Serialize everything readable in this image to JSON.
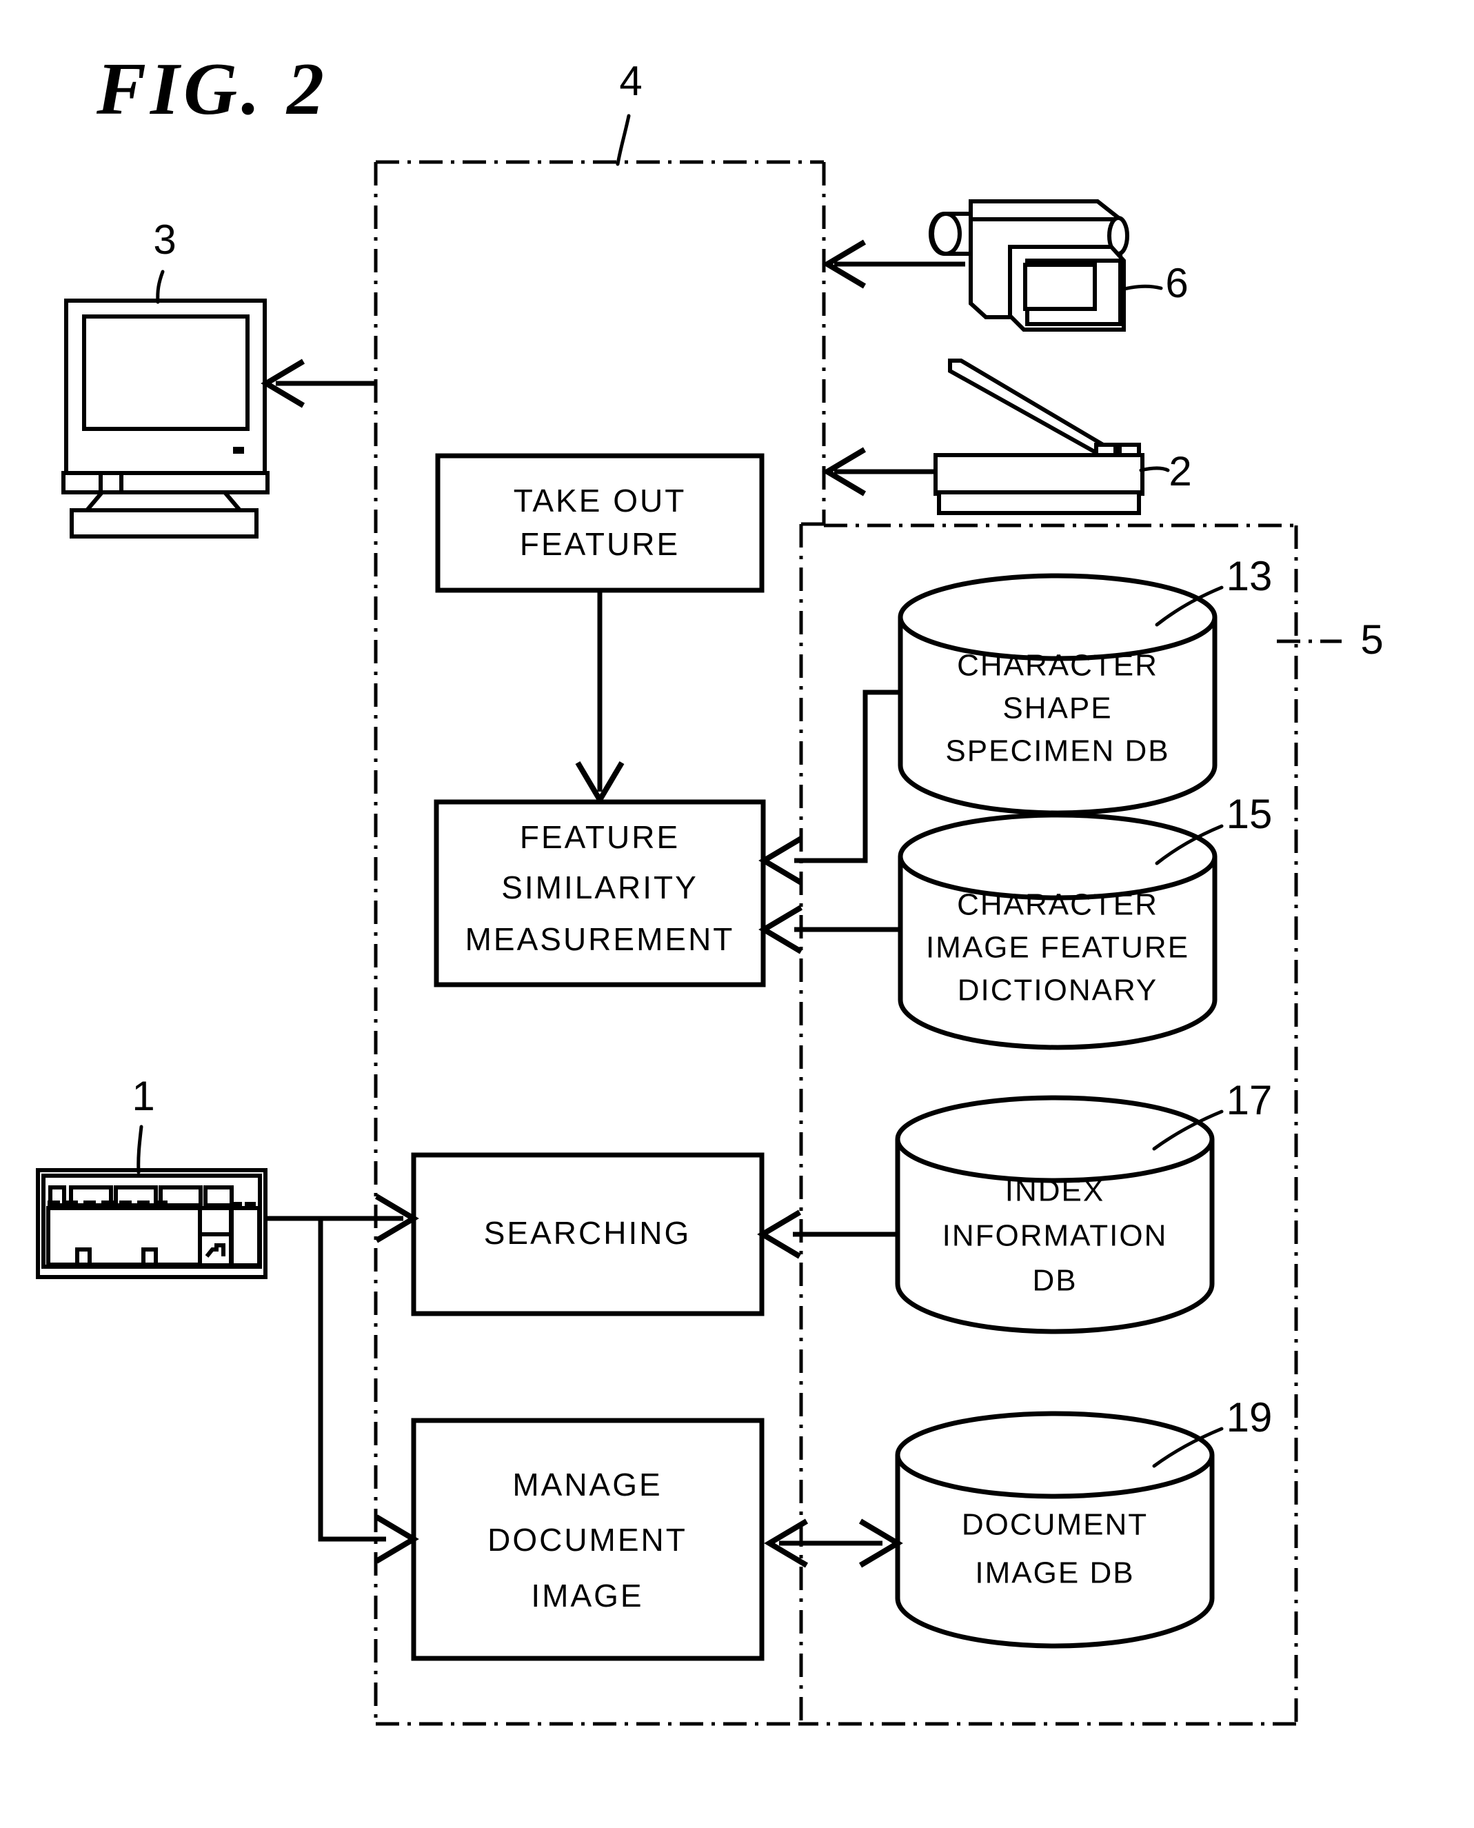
{
  "figure": {
    "title": "FIG. 2",
    "domain": "patent-block-diagram"
  },
  "process_boxes": [
    {
      "id": "take-out-feature",
      "lines": [
        "TAKE OUT",
        "FEATURE"
      ]
    },
    {
      "id": "feature-similarity-measurement",
      "lines": [
        "FEATURE",
        "SIMILARITY",
        "MEASUREMENT"
      ]
    },
    {
      "id": "searching",
      "lines": [
        "SEARCHING"
      ]
    },
    {
      "id": "manage-document-image",
      "lines": [
        "MANAGE",
        "DOCUMENT",
        "IMAGE"
      ]
    }
  ],
  "databases": [
    {
      "id": "character-shape-specimen-db",
      "lines": [
        "CHARACTER",
        "SHAPE",
        "SPECIMEN DB"
      ],
      "ref": "13"
    },
    {
      "id": "character-image-feature-dictionary",
      "lines": [
        "CHARACTER",
        "IMAGE FEATURE",
        "DICTIONARY"
      ],
      "ref": "15"
    },
    {
      "id": "index-information-db",
      "lines": [
        "INDEX",
        "INFORMATION",
        "DB"
      ],
      "ref": "17"
    },
    {
      "id": "document-image-db",
      "lines": [
        "DOCUMENT",
        "IMAGE DB"
      ],
      "ref": "19"
    }
  ],
  "devices": [
    {
      "id": "display-monitor",
      "ref": "3",
      "icon": "crt-monitor-icon"
    },
    {
      "id": "video-camera",
      "ref": "6",
      "icon": "video-camera-icon"
    },
    {
      "id": "image-scanner",
      "ref": "2",
      "icon": "flatbed-scanner-icon"
    },
    {
      "id": "keyboard",
      "ref": "1",
      "icon": "keyboard-icon"
    }
  ],
  "regions": [
    {
      "id": "processing-unit-region",
      "ref": "4"
    },
    {
      "id": "storage-unit-region",
      "ref": "5"
    }
  ],
  "ref_numerals": {
    "keyboard": "1",
    "scanner": "2",
    "monitor": "3",
    "processing_region": "4",
    "storage_region": "5",
    "camera": "6",
    "character_shape_specimen_db": "13",
    "character_image_feature_dictionary": "15",
    "index_information_db": "17",
    "document_image_db": "19"
  },
  "colors": {
    "ink": "#000000",
    "paper": "#ffffff"
  }
}
